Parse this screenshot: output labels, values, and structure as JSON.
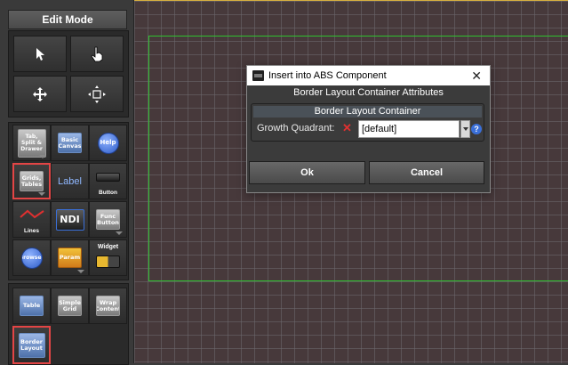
{
  "palette": {
    "header": "Edit Mode",
    "tools_row1": [
      {
        "label": "Tab, Split & Drawer"
      },
      {
        "label": "Basic Canvas"
      },
      {
        "label": "Help"
      }
    ],
    "tools_row2": [
      {
        "label": "Grids, Tables"
      },
      {
        "label": "Label"
      },
      {
        "label": "Button"
      }
    ],
    "tools_row3": [
      {
        "label": "Lines"
      },
      {
        "label": "NDI"
      },
      {
        "label": "Func Button"
      }
    ],
    "tools_row4": [
      {
        "label": "Browser"
      },
      {
        "label": "Param"
      },
      {
        "label": "Widget"
      }
    ],
    "tools_row5": [
      {
        "label": "Table"
      },
      {
        "label": "Simple Grid"
      },
      {
        "label": "Wrap Content"
      }
    ],
    "tools_row6": [
      {
        "label": "Border Layout"
      }
    ]
  },
  "dialog": {
    "title": "Insert into ABS Component",
    "subtitle": "Border Layout Container Attributes",
    "group_header": "Border Layout Container",
    "field_label": "Growth Quadrant:",
    "field_value": "[default]",
    "help_glyph": "?",
    "ok_label": "Ok",
    "cancel_label": "Cancel",
    "close_glyph": "✕"
  },
  "colors": {
    "canvas_bg": "#47393b",
    "frame_green": "#2fc12f",
    "selected_red": "#e24545",
    "canvas_top_border": "#d8b040"
  }
}
